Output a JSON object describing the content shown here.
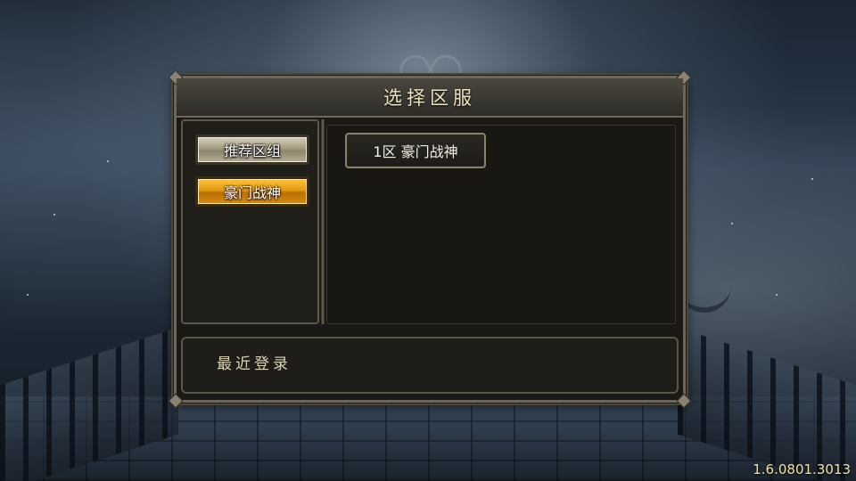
{
  "dialog": {
    "title": "选择区服"
  },
  "groups": [
    {
      "label": "推荐区组",
      "state": "normal"
    },
    {
      "label": "豪门战神",
      "state": "selected"
    }
  ],
  "servers": [
    {
      "label": "1区 豪门战神"
    }
  ],
  "recent": {
    "label": "最近登录"
  },
  "version": "1.6.0801.3013",
  "colors": {
    "selected_accent": "#e29a12",
    "panel_border": "#6e6757",
    "title_text": "#efe2c0"
  }
}
